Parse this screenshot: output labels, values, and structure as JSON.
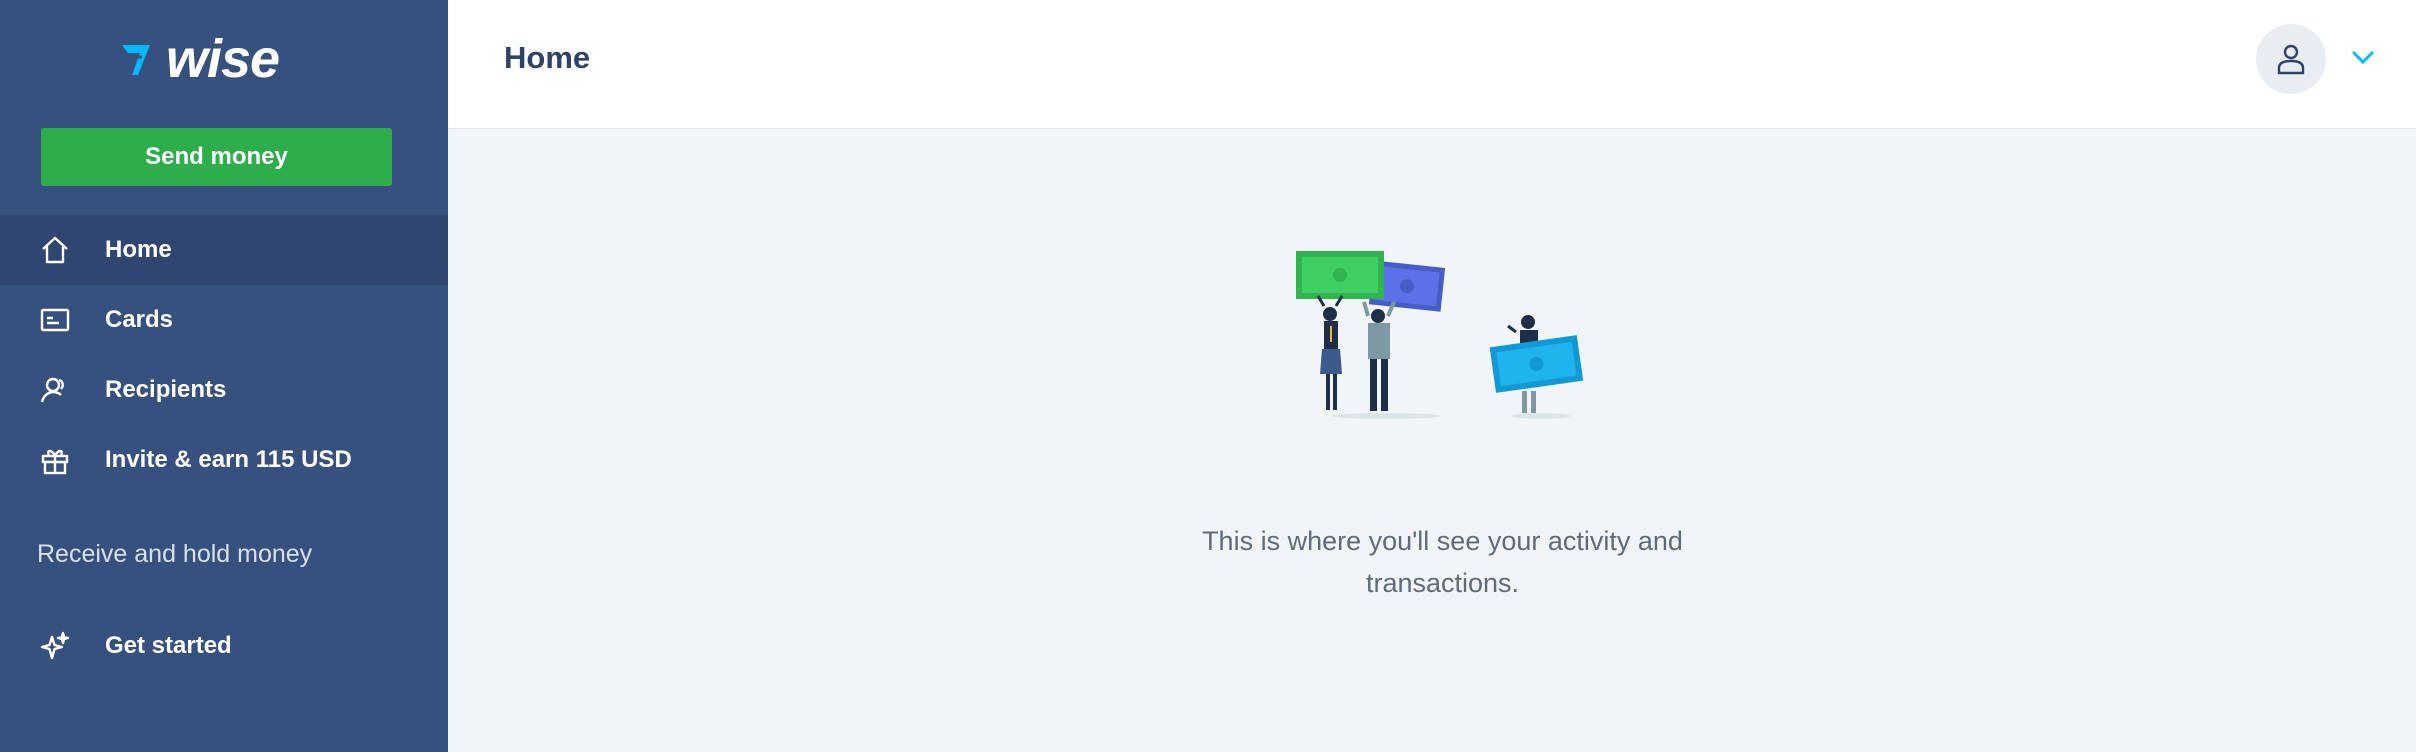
{
  "brand": {
    "name": "wise"
  },
  "sidebar": {
    "send_button": "Send money",
    "items": [
      {
        "label": "Home",
        "icon": "home-icon",
        "active": true
      },
      {
        "label": "Cards",
        "icon": "card-icon",
        "active": false
      },
      {
        "label": "Recipients",
        "icon": "recipients-icon",
        "active": false
      },
      {
        "label": "Invite & earn 115 USD",
        "icon": "gift-icon",
        "active": false
      }
    ],
    "section_title": "Receive and hold money",
    "get_started": {
      "label": "Get started",
      "icon": "sparkle-icon"
    }
  },
  "header": {
    "title": "Home",
    "avatar_icon": "user-icon",
    "menu_icon": "chevron-down-icon"
  },
  "main": {
    "empty_state_text": "This is where you'll see your activity and transactions."
  },
  "colors": {
    "sidebar_bg": "#37517e",
    "sidebar_active": "#2f4670",
    "send_button": "#2ead4b",
    "accent_blue": "#00b9ff",
    "page_bg": "#f2f5f7"
  }
}
